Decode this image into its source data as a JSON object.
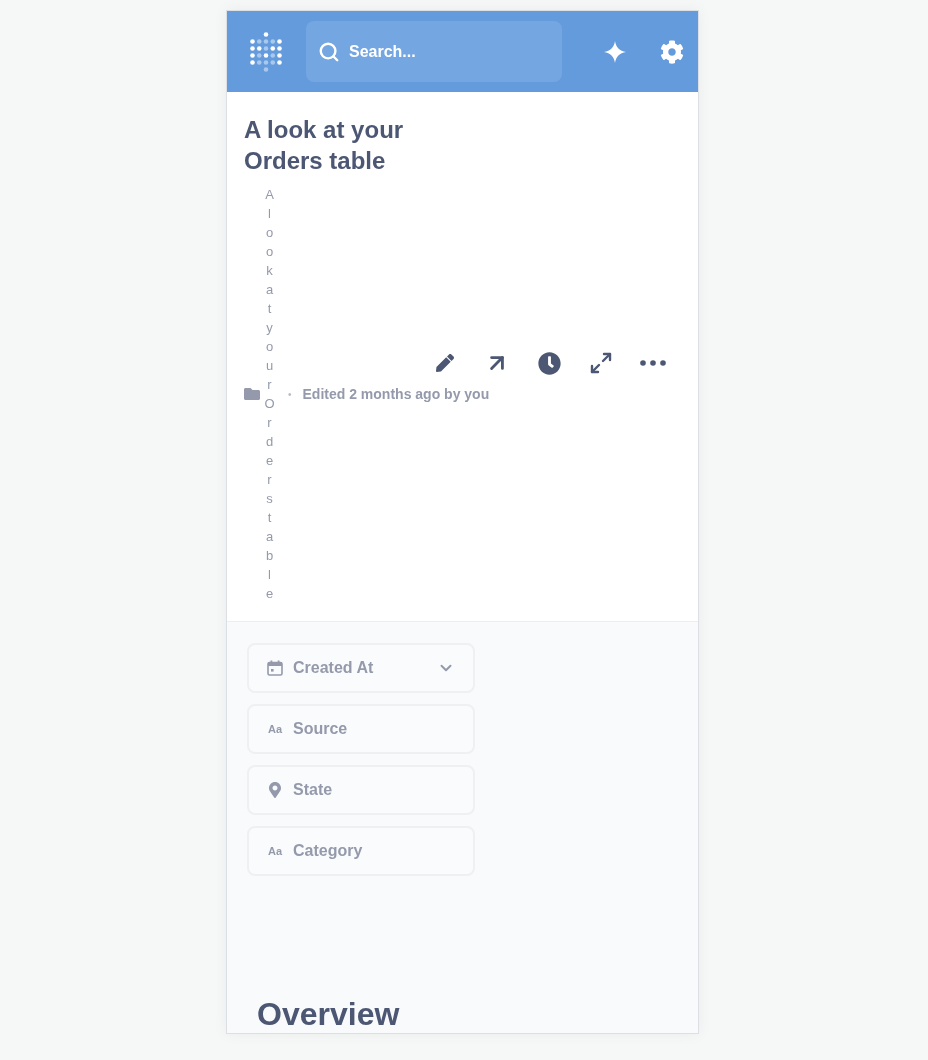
{
  "header": {
    "search": {
      "placeholder": "Search..."
    }
  },
  "dashboard": {
    "title": "A look at your Orders table",
    "collection_title": "A look at your Orders table",
    "separator": "•",
    "edited": "Edited 2 months ago by you"
  },
  "filters": [
    {
      "kind": "date",
      "label": "Created At",
      "dropdown": true
    },
    {
      "kind": "text",
      "type_label": "Aa",
      "label": "Source",
      "dropdown": false
    },
    {
      "kind": "location",
      "label": "State",
      "dropdown": false
    },
    {
      "kind": "text",
      "type_label": "Aa",
      "label": "Category",
      "dropdown": false
    }
  ],
  "sections": [
    {
      "heading": "Overview"
    }
  ]
}
